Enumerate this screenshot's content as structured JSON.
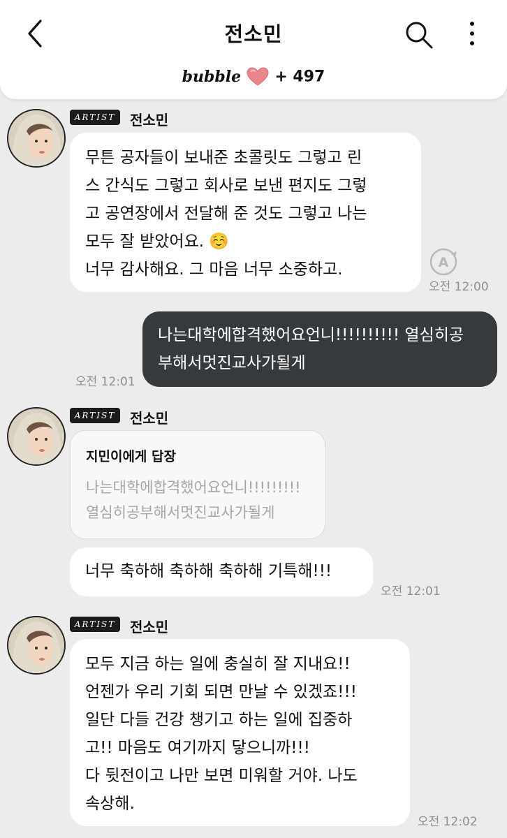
{
  "header": {
    "title": "전소민",
    "brand": "bubble",
    "plus_count": "+ 497"
  },
  "messages": [
    {
      "artist_tag": "ARTIST",
      "sender": "전소민",
      "lines": [
        "무튼 공자들이 보내준 초콜릿도 그렇고 린",
        "스 간식도 그렇고 회사로 보낸 편지도 그렇",
        "고 공연장에서 전달해 준 것도 그렇고 나는",
        "모두 잘 받았어요. ☺️",
        "너무 감사해요. 그 마음 너무 소중하고."
      ],
      "time": "오전 12:00"
    },
    {
      "outgoing": true,
      "lines": [
        "나는대학에합격했어요언니!!!!!!!!!! 열심히공",
        "부해서멋진교사가될게"
      ],
      "time": "오전 12:01"
    },
    {
      "artist_tag": "ARTIST",
      "sender": "전소민",
      "reply_to": {
        "title": "지민이에게 답장",
        "lines": [
          "나는대학에합격했어요언니!!!!!!!!!",
          "열심히공부해서멋진교사가될게"
        ]
      },
      "lines": [
        "너무 축하해 축하해 축하해 기특해!!!"
      ],
      "time": "오전 12:01"
    },
    {
      "artist_tag": "ARTIST",
      "sender": "전소민",
      "lines": [
        "모두 지금 하는 일에 충실히 잘 지내요!!",
        "언젠가 우리 기회 되면 만날 수 있겠죠!!!",
        "일단 다들 건강 챙기고 하는 일에 집중하",
        "고!! 마음도 여기까지 닿으니까!!!",
        "다 뒷전이고 나만 보면 미워할 거야. 나도",
        "속상해."
      ],
      "time": "오전 12:02"
    }
  ],
  "colors": {
    "background": "#ececec",
    "incoming_bubble": "#ffffff",
    "outgoing_bubble": "#363a3d",
    "heart": "#e8868c"
  },
  "icons": [
    "back-arrow-icon",
    "search-icon",
    "more-vertical-icon",
    "heart-icon",
    "auto-translate-icon"
  ]
}
